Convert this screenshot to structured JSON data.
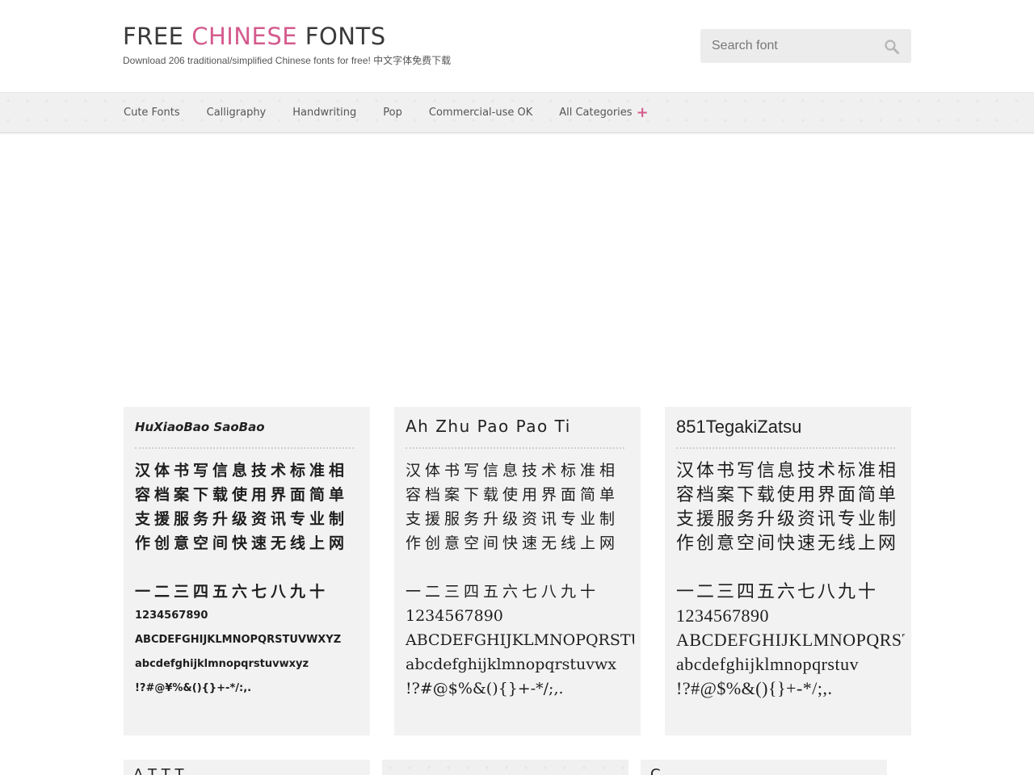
{
  "header": {
    "title_part1": "FREE ",
    "title_accent": "CHINESE",
    "title_part2": " FONTS",
    "tagline": "Download 206 traditional/simplified Chinese fonts for free! 中文字体免费下载"
  },
  "search": {
    "placeholder": "Search font",
    "icon": "search-icon"
  },
  "nav": {
    "items": [
      {
        "label": "Cute Fonts"
      },
      {
        "label": "Calligraphy"
      },
      {
        "label": "Handwriting"
      },
      {
        "label": "Pop"
      },
      {
        "label": "Commercial-use OK"
      },
      {
        "label": "All Categories",
        "icon": "plus-icon"
      }
    ]
  },
  "sample_text": {
    "cjk_lines": [
      "汉体书写信息技术标准相",
      "容档案下载使用界面简单",
      "支援服务升级资讯专业制",
      "作创意空间快速无线上网"
    ],
    "cjk_numerals": "一二三四五六七八九十",
    "digits": "1234567890",
    "uppercase": "ABCDEFGHIJKLMNOPQRSTUVWXYZ",
    "uppercase_2": "ABCDEFGHIJKLMNOPQRSTUV",
    "uppercase_3": "ABCDEFGHIJKLMNOPQRSTUV",
    "lowercase": "abcdefghijklmnopqrstuvwxyz",
    "lowercase_2": "abcdefghijklmnopqrstuvwx",
    "lowercase_3": "abcdefghijklmnopqrstuv",
    "symbols_1": "!?#@¥%&(){}+-*/:,.",
    "symbols_2": "!?#@$%&(){}+-*/;,.",
    "symbols_3": "!?#@$%&(){}+-*/;,."
  },
  "fonts": [
    {
      "name": "HuXiaoBao SaoBao"
    },
    {
      "name": "Ah Zhu Pao Pao Ti"
    },
    {
      "name": "851TegakiZatsu"
    }
  ],
  "peek_fonts": [
    {
      "name": "A  T  T  T"
    },
    {
      "name": ""
    },
    {
      "name": "C"
    }
  ],
  "colors": {
    "accent": "#d45b8d",
    "card_bg": "#f2f2f2",
    "nav_bg": "#f0f0f0"
  }
}
